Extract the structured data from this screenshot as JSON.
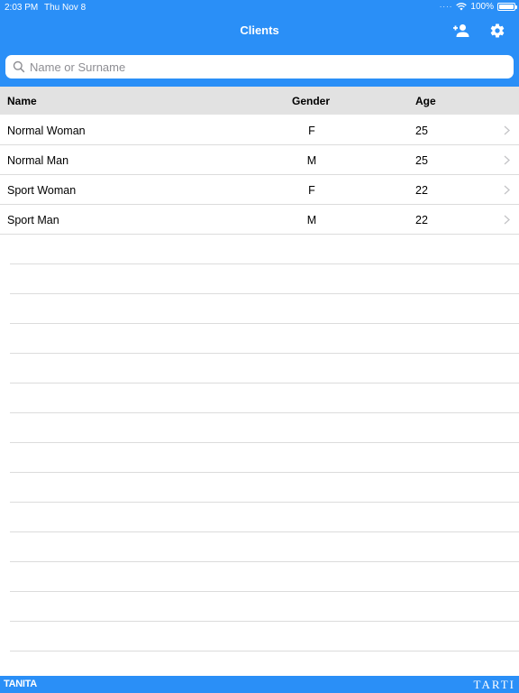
{
  "status_bar": {
    "time": "2:03 PM",
    "date": "Thu Nov 8",
    "battery": "100%"
  },
  "nav": {
    "title": "Clients",
    "add_icon": "add-person-icon",
    "settings_icon": "gear-icon"
  },
  "search": {
    "placeholder": "Name or Surname",
    "value": ""
  },
  "table": {
    "headers": {
      "name": "Name",
      "gender": "Gender",
      "age": "Age"
    },
    "rows": [
      {
        "name": "Normal Woman",
        "gender": "F",
        "age": "25"
      },
      {
        "name": "Normal Man",
        "gender": "M",
        "age": "25"
      },
      {
        "name": "Sport Woman",
        "gender": "F",
        "age": "22"
      },
      {
        "name": "Sport Man",
        "gender": "M",
        "age": "22"
      }
    ]
  },
  "footer": {
    "left_logo": "TANITA",
    "right_logo": "TARTI"
  },
  "colors": {
    "accent": "#2a8ff7",
    "header_bg": "#e2e2e2"
  }
}
